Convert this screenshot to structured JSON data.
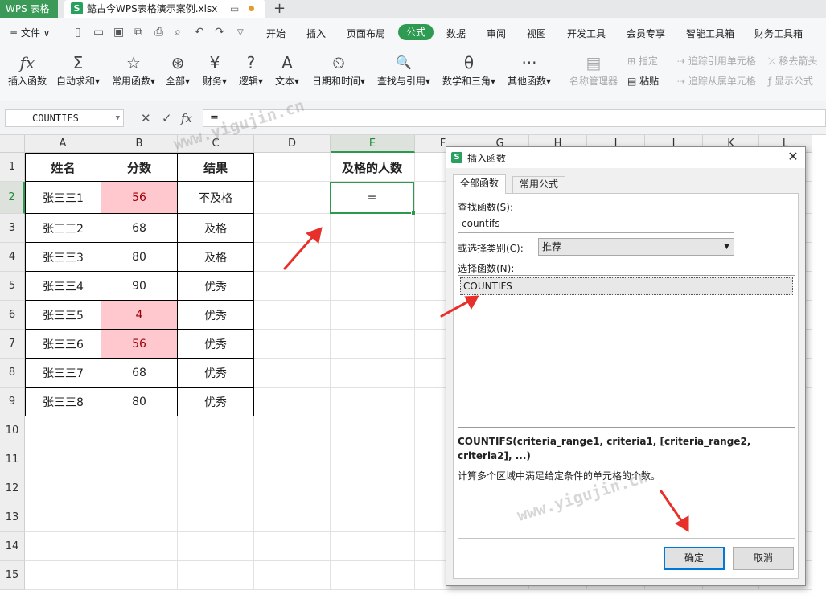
{
  "titlebar": {
    "app_name": "WPS 表格",
    "doc_logo": "S",
    "doc_title": "懿古今WPS表格演示案例.xlsx",
    "new_tab": "+"
  },
  "menubar": {
    "file": "≡ 文件 ∨",
    "tabs": [
      "开始",
      "插入",
      "页面布局",
      "公式",
      "数据",
      "审阅",
      "视图",
      "开发工具",
      "会员专享",
      "智能工具箱",
      "财务工具箱"
    ],
    "active_tab": "公式"
  },
  "ribbon": {
    "buttons": [
      {
        "icon": "fx",
        "label": "插入函数"
      },
      {
        "icon": "Σ",
        "label": "自动求和▾"
      },
      {
        "icon": "☆",
        "label": "常用函数▾"
      },
      {
        "icon": "⊛",
        "label": "全部▾"
      },
      {
        "icon": "¥",
        "label": "财务▾"
      },
      {
        "icon": "?",
        "label": "逻辑▾"
      },
      {
        "icon": "A",
        "label": "文本▾"
      },
      {
        "icon": "⏲",
        "label": "日期和时间▾"
      },
      {
        "icon": "🔍",
        "label": "查找与引用▾"
      },
      {
        "icon": "θ",
        "label": "数学和三角▾"
      },
      {
        "icon": "···",
        "label": "其他函数▾"
      }
    ],
    "name_manager": "名称管理器",
    "define": "指定",
    "paste": "粘贴",
    "trace_precedents": "追踪引用单元格",
    "trace_dependents": "追踪从属单元格",
    "remove_arrows": "移去箭头",
    "show_formulas": "显示公式"
  },
  "formula_bar": {
    "name_box": "COUNTIFS",
    "value": "="
  },
  "sheet": {
    "columns": [
      "A",
      "B",
      "C",
      "D",
      "E",
      "F",
      "G",
      "H",
      "I",
      "J",
      "K",
      "L"
    ],
    "rows": [
      "1",
      "2",
      "3",
      "4",
      "5",
      "6",
      "7",
      "8",
      "9",
      "10",
      "11",
      "12",
      "13",
      "14",
      "15"
    ],
    "header": [
      "姓名",
      "分数",
      "结果"
    ],
    "data": [
      [
        "张三三1",
        "56",
        "不及格"
      ],
      [
        "张三三2",
        "68",
        "及格"
      ],
      [
        "张三三3",
        "80",
        "及格"
      ],
      [
        "张三三4",
        "90",
        "优秀"
      ],
      [
        "张三三5",
        "4",
        "优秀"
      ],
      [
        "张三三6",
        "56",
        "优秀"
      ],
      [
        "张三三7",
        "68",
        "优秀"
      ],
      [
        "张三三8",
        "80",
        "优秀"
      ]
    ],
    "e1": "及格的人数",
    "e2": "=",
    "highlight_color": "#ffc7ce"
  },
  "dialog": {
    "title": "插入函数",
    "close": "✕",
    "tabs": [
      "全部函数",
      "常用公式"
    ],
    "search_label": "查找函数(S):",
    "search_value": "countifs",
    "category_label": "或选择类别(C):",
    "category_value": "推荐",
    "list_label": "选择函数(N):",
    "list_items": [
      "COUNTIFS"
    ],
    "signature": "COUNTIFS(criteria_range1, criteria1, [criteria_range2, criteria2], ...)",
    "description": "计算多个区域中满足给定条件的单元格的个数。",
    "ok": "确定",
    "cancel": "取消"
  },
  "watermarks": [
    "www.yigujin.cn",
    "www.yigujin.cn"
  ],
  "colors": {
    "accent": "#2f9b52",
    "arrow": "#e8302a"
  }
}
